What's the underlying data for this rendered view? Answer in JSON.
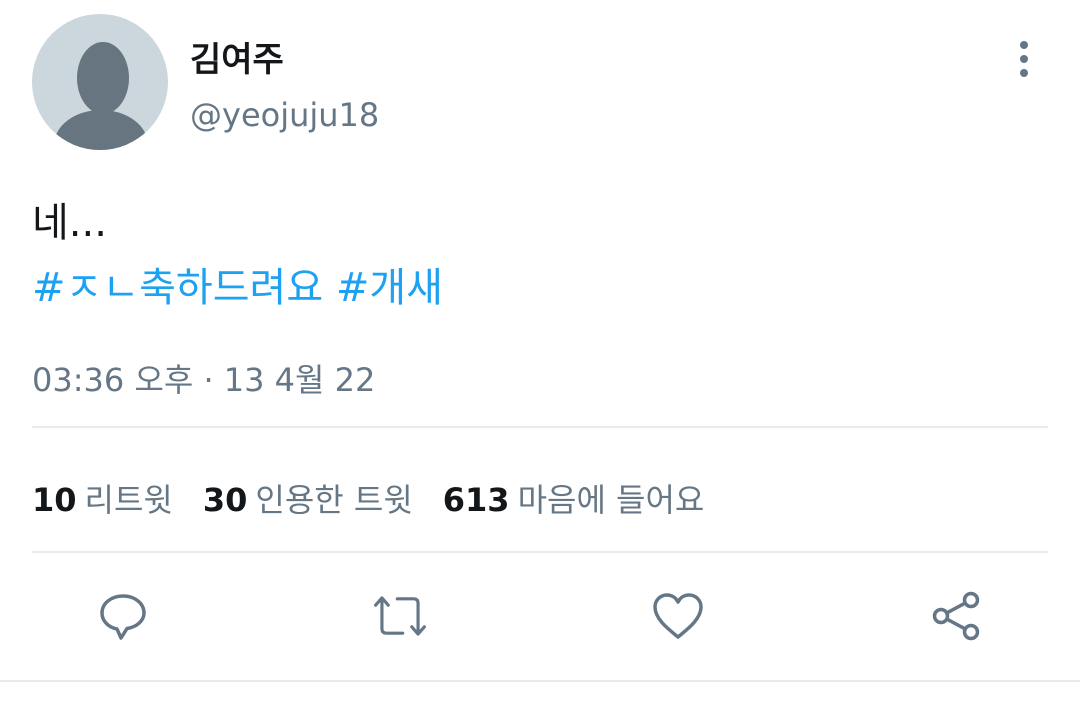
{
  "user": {
    "display_name": "김여주",
    "handle": "@yeojuju18"
  },
  "tweet": {
    "text": "네...",
    "hashtags": [
      "#ㅈㄴ축하드려요",
      "#개새"
    ],
    "timestamp": "03:36 오후 · 13 4월 22"
  },
  "stats": [
    {
      "count": "10",
      "label": "리트윗"
    },
    {
      "count": "30",
      "label": "인용한 트윗"
    },
    {
      "count": "613",
      "label": "마음에 들어요"
    }
  ],
  "colors": {
    "link": "#1da1f2",
    "secondary_text": "#657786",
    "divider": "#e6ecf0",
    "avatar_bg": "#ccd6dd"
  },
  "icons": [
    "more-vertical-icon",
    "reply-icon",
    "retweet-icon",
    "like-icon",
    "share-icon"
  ]
}
